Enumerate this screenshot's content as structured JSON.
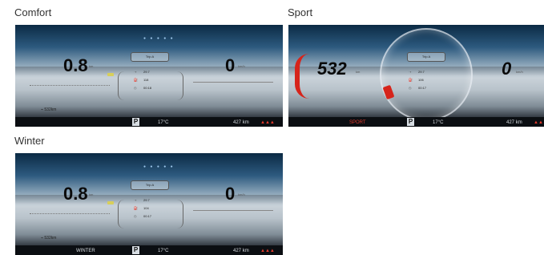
{
  "modes": [
    {
      "caption": "Comfort",
      "speed": "0.8",
      "speed_unit": "km",
      "right_value": "0",
      "right_unit": "km/h",
      "trip_label": "Trip A",
      "trip_distance": "29.7",
      "trip_consumption": "118",
      "trip_time": "00:18",
      "range_top": "532",
      "range_top_unit": "km",
      "temperature": "17",
      "temperature_unit": "°C",
      "range_bottom": "427",
      "range_bottom_unit": "km",
      "gear": "P",
      "mode_tag": ""
    },
    {
      "caption": "Sport",
      "speed": "532",
      "speed_unit": "km",
      "right_value": "0",
      "right_unit": "km/h",
      "trip_label": "Trip A",
      "trip_distance": "29.7",
      "trip_consumption": "106",
      "trip_time": "00:17",
      "range_top": "",
      "range_top_unit": "",
      "temperature": "17",
      "temperature_unit": "°C",
      "range_bottom": "427",
      "range_bottom_unit": "km",
      "gear": "P",
      "mode_tag": "SPORT"
    },
    {
      "caption": "Winter",
      "speed": "0.8",
      "speed_unit": "km",
      "right_value": "0",
      "right_unit": "km/h",
      "trip_label": "Trip A",
      "trip_distance": "29.7",
      "trip_consumption": "104",
      "trip_time": "00:17",
      "range_top": "532",
      "range_top_unit": "km",
      "temperature": "17",
      "temperature_unit": "°C",
      "range_bottom": "427",
      "range_bottom_unit": "km",
      "gear": "P",
      "mode_tag": "WINTER"
    }
  ],
  "colors": {
    "accent_red": "#d6241b",
    "eco_yellow": "#d8cf5a",
    "strip_bg": "#0b0e12"
  }
}
